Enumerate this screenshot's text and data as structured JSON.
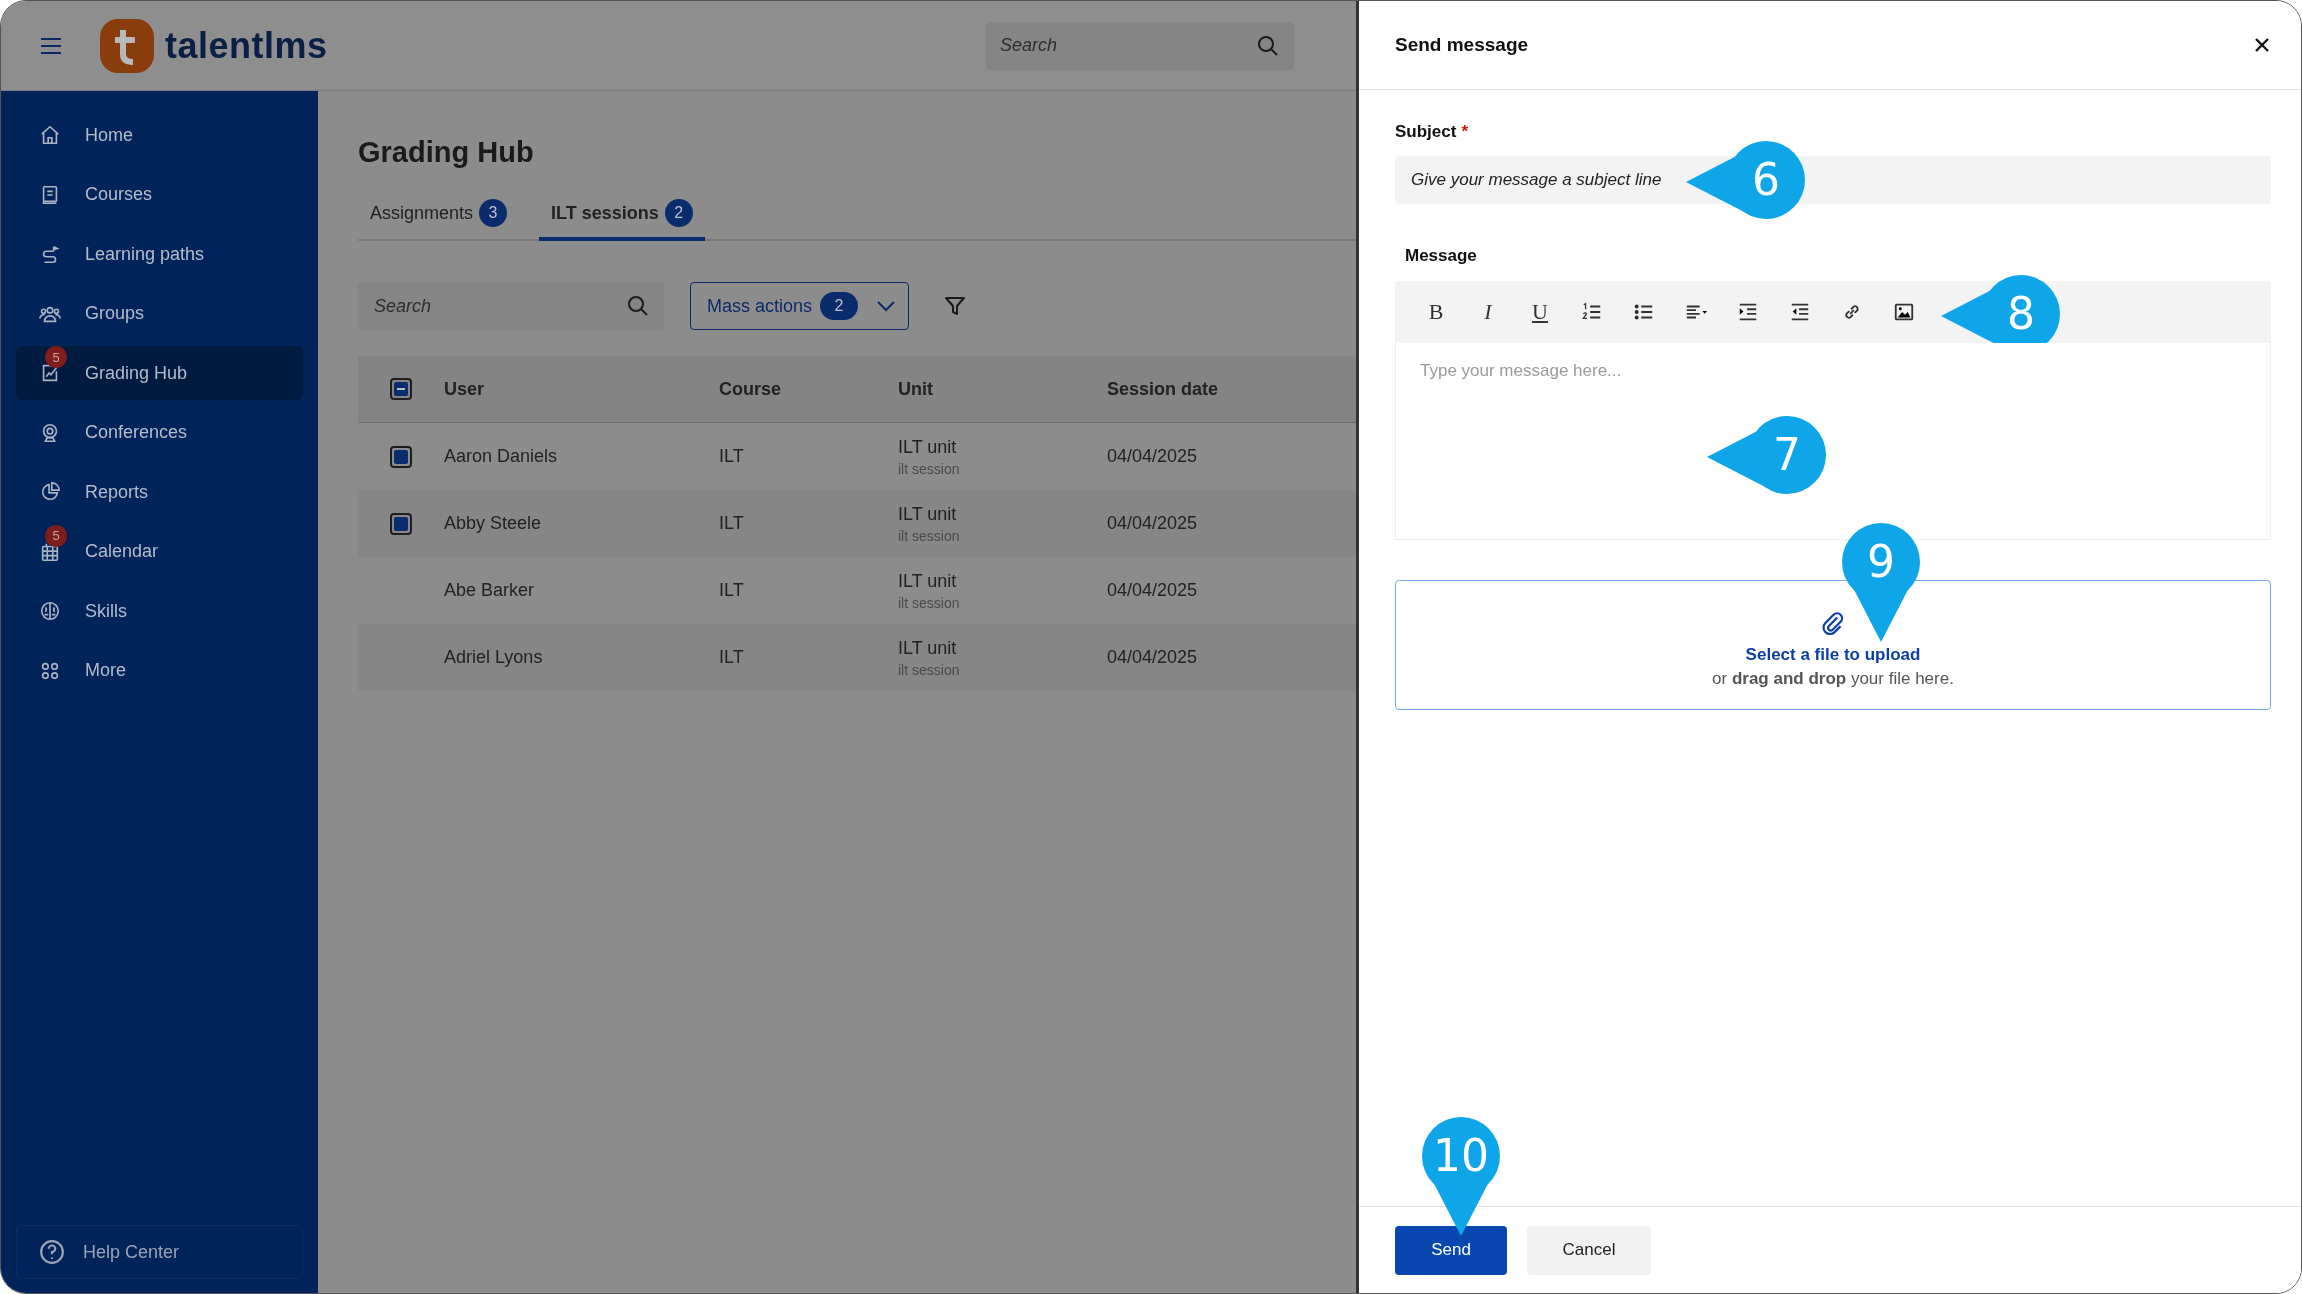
{
  "topbar": {
    "logo_text": "talentlms",
    "search": {
      "placeholder": "Search"
    }
  },
  "sidebar": {
    "items": [
      {
        "label": "Home",
        "selected": false
      },
      {
        "label": "Courses",
        "selected": false
      },
      {
        "label": "Learning paths",
        "selected": false
      },
      {
        "label": "Groups",
        "selected": false
      },
      {
        "label": "Grading Hub",
        "selected": true,
        "badge": "5"
      },
      {
        "label": "Conferences",
        "selected": false
      },
      {
        "label": "Reports",
        "selected": false
      },
      {
        "label": "Calendar",
        "selected": false,
        "badge": "5"
      },
      {
        "label": "Skills",
        "selected": false
      },
      {
        "label": "More",
        "selected": false
      }
    ],
    "help": {
      "label": "Help Center"
    }
  },
  "page": {
    "title": "Grading Hub",
    "tabs": [
      {
        "label": "Assignments",
        "count": "3",
        "selected": false
      },
      {
        "label": "ILT sessions",
        "count": "2",
        "selected": true
      }
    ],
    "search": {
      "placeholder": "Search"
    },
    "mass_actions": {
      "label": "Mass actions",
      "count": "2"
    }
  },
  "table": {
    "select_all": {
      "indeterminate": true
    },
    "columns": [
      "User",
      "Course",
      "Unit",
      "Session date"
    ],
    "rows": [
      {
        "user": "Aaron Daniels",
        "course": "ILT",
        "unit": "ILT unit",
        "unit_detail": "ilt session",
        "date": "04/04/2025",
        "checked": true
      },
      {
        "user": "Abby Steele",
        "course": "ILT",
        "unit": "ILT unit",
        "unit_detail": "ilt session",
        "date": "04/04/2025",
        "checked": true
      },
      {
        "user": "Abe Barker",
        "course": "ILT",
        "unit": "ILT unit",
        "unit_detail": "ilt session",
        "date": "04/04/2025",
        "checked": false
      },
      {
        "user": "Adriel Lyons",
        "course": "ILT",
        "unit": "ILT unit",
        "unit_detail": "ilt session",
        "date": "04/04/2025",
        "checked": false
      }
    ]
  },
  "dialog": {
    "title": "Send message",
    "subject": {
      "label": "Subject",
      "required_mark": "*",
      "placeholder": "Give your message a subject line",
      "callout": {
        "number": "6"
      }
    },
    "message": {
      "label": "Message",
      "toolbar": [
        {
          "kind": "bold",
          "label": "B"
        },
        {
          "kind": "italic",
          "label": "I"
        },
        {
          "kind": "underline",
          "label": "U"
        },
        {
          "kind": "ordered_list"
        },
        {
          "kind": "bullet_list"
        },
        {
          "kind": "align"
        },
        {
          "kind": "indent"
        },
        {
          "kind": "outdent"
        },
        {
          "kind": "link"
        },
        {
          "kind": "image"
        }
      ],
      "toolbar_callout": {
        "number": "8"
      },
      "placeholder": "Type your message here...",
      "callout": {
        "number": "7"
      }
    },
    "upload": {
      "link": "Select a file to upload",
      "hint": "or **drag and drop** your file here.",
      "callout": {
        "number": "9"
      }
    },
    "buttons": [
      {
        "label": "Send",
        "kind": "primary",
        "callout": {
          "number": "10"
        }
      },
      {
        "label": "Cancel",
        "kind": "secondary"
      }
    ]
  }
}
